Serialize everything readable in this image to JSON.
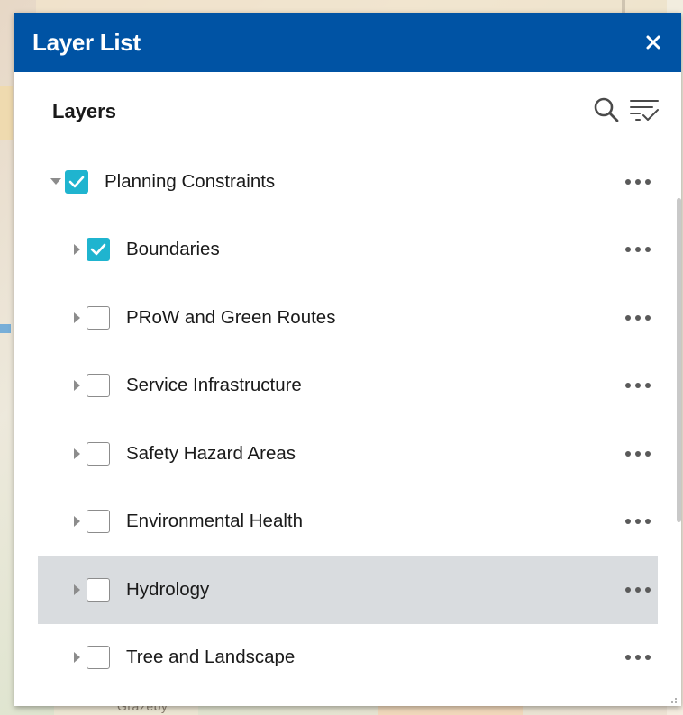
{
  "panel": {
    "title": "Layer List",
    "close_icon": "close-icon",
    "header_color": "#0053a4"
  },
  "toolbar": {
    "heading": "Layers",
    "search_icon": "search-icon",
    "filter_icon": "filter-list-icon"
  },
  "layers": [
    {
      "label": "Planning Constraints",
      "level": 0,
      "checked": true,
      "expanded": true
    },
    {
      "label": "Boundaries",
      "level": 1,
      "checked": true,
      "expanded": false
    },
    {
      "label": "PRoW and Green Routes",
      "level": 1,
      "checked": false,
      "expanded": false
    },
    {
      "label": "Service Infrastructure",
      "level": 1,
      "checked": false,
      "expanded": false
    },
    {
      "label": "Safety Hazard Areas",
      "level": 1,
      "checked": false,
      "expanded": false
    },
    {
      "label": "Environmental Health",
      "level": 1,
      "checked": false,
      "expanded": false
    },
    {
      "label": "Hydrology",
      "level": 1,
      "checked": false,
      "expanded": false,
      "highlighted": true
    },
    {
      "label": "Tree and Landscape",
      "level": 1,
      "checked": false,
      "expanded": false
    }
  ],
  "map": {
    "partial_label": "Grazeby"
  },
  "colors": {
    "checkbox_checked": "#1fb4cf",
    "row_highlight": "#d9dcdf"
  }
}
